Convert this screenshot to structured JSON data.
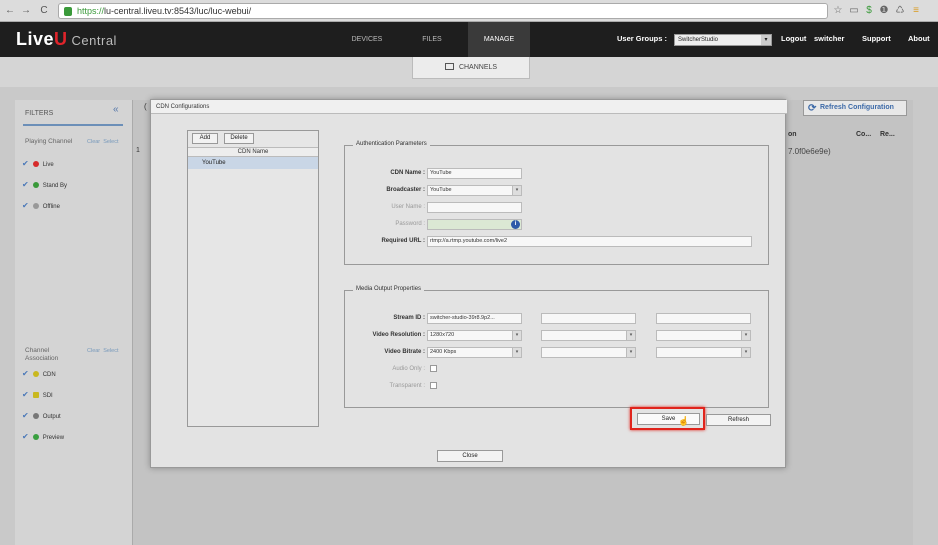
{
  "browser": {
    "url_proto": "https://",
    "url_rest": "lu-central.liveu.tv:8543/luc/luc-webui/",
    "nav": {
      "back": "←",
      "forward": "→",
      "reload": "C"
    }
  },
  "header": {
    "logo_main": "Live",
    "logo_u": "U",
    "logo_sub": "Central",
    "tabs": [
      "DEVICES",
      "FILES",
      "MANAGE"
    ],
    "user_groups_label": "User Groups :",
    "user_group_value": "SwitcherStudio",
    "logout_label": "Logout",
    "username": "switcher",
    "support_label": "Support",
    "about_label": "About"
  },
  "subnav": {
    "channels_label": "CHANNELS"
  },
  "filters": {
    "title": "FILTERS",
    "collapse": "«",
    "playing_group": "Playing Channel",
    "clear": "Clear",
    "select": "Select",
    "playing_items": [
      {
        "label": "Live",
        "color": "#d62b2b"
      },
      {
        "label": "Stand By",
        "color": "#3a9a3a"
      },
      {
        "label": "Offline",
        "color": "#999999"
      }
    ],
    "assoc_group": "Channel Association",
    "assoc_items": [
      {
        "label": "CDN",
        "color": "#c9b81f"
      },
      {
        "label": "SDI",
        "color": "#c9b81f"
      },
      {
        "label": "Output",
        "color": "#777777"
      },
      {
        "label": "Preview",
        "color": "#3aa040"
      }
    ]
  },
  "background": {
    "refresh_label": "Refresh Configuration",
    "col_on": "on",
    "col_co": "Co...",
    "col_re": "Re...",
    "row_value": "7.0f0e6e9e)",
    "row_num": "1",
    "bracket": "("
  },
  "modal": {
    "title": "CDN Configurations",
    "add_label": "Add",
    "delete_label": "Delete",
    "list_header": "CDN Name",
    "list_items": [
      "YouTube"
    ],
    "auth": {
      "legend": "Authentication Parameters",
      "cdn_name_label": "CDN Name :",
      "cdn_name_value": "YouTube",
      "broadcaster_label": "Broadcaster :",
      "broadcaster_value": "YouTube",
      "username_label": "User Name :",
      "username_value": "",
      "password_label": "Password :",
      "password_value": "",
      "required_url_label": "Required URL :",
      "required_url_value": "rtmp://a.rtmp.youtube.com/live2"
    },
    "media": {
      "legend": "Media Output Properties",
      "stream_id_label": "Stream ID :",
      "stream_id_value": "switcher-studio-39r8.9p2...",
      "video_res_label": "Video Resolution :",
      "video_res_value": "1280x720",
      "video_bitrate_label": "Video Bitrate :",
      "video_bitrate_value": "2400 Kbps",
      "audio_only_label": "Audio Only :",
      "transparent_label": "Transparent :"
    },
    "save_label": "Save",
    "refresh_label": "Refresh",
    "close_label": "Close"
  }
}
